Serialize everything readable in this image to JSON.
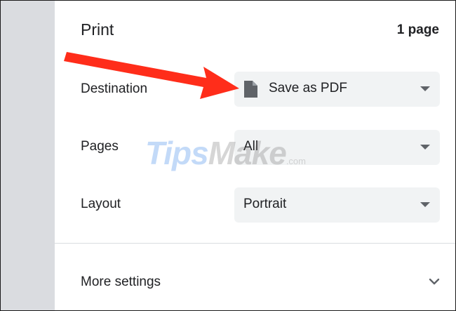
{
  "dialog": {
    "title": "Print",
    "page_count": "1 page"
  },
  "settings": {
    "destination": {
      "label": "Destination",
      "value": "Save as PDF",
      "icon": "document-icon"
    },
    "pages": {
      "label": "Pages",
      "value": "All"
    },
    "layout": {
      "label": "Layout",
      "value": "Portrait"
    }
  },
  "more_settings": {
    "label": "More settings",
    "icon": "chevron-down-icon"
  },
  "watermark": {
    "brand_a": "Tips",
    "brand_b": "Make",
    "suffix": ".com"
  },
  "annotation": {
    "arrow_color": "#ff2d1a"
  }
}
